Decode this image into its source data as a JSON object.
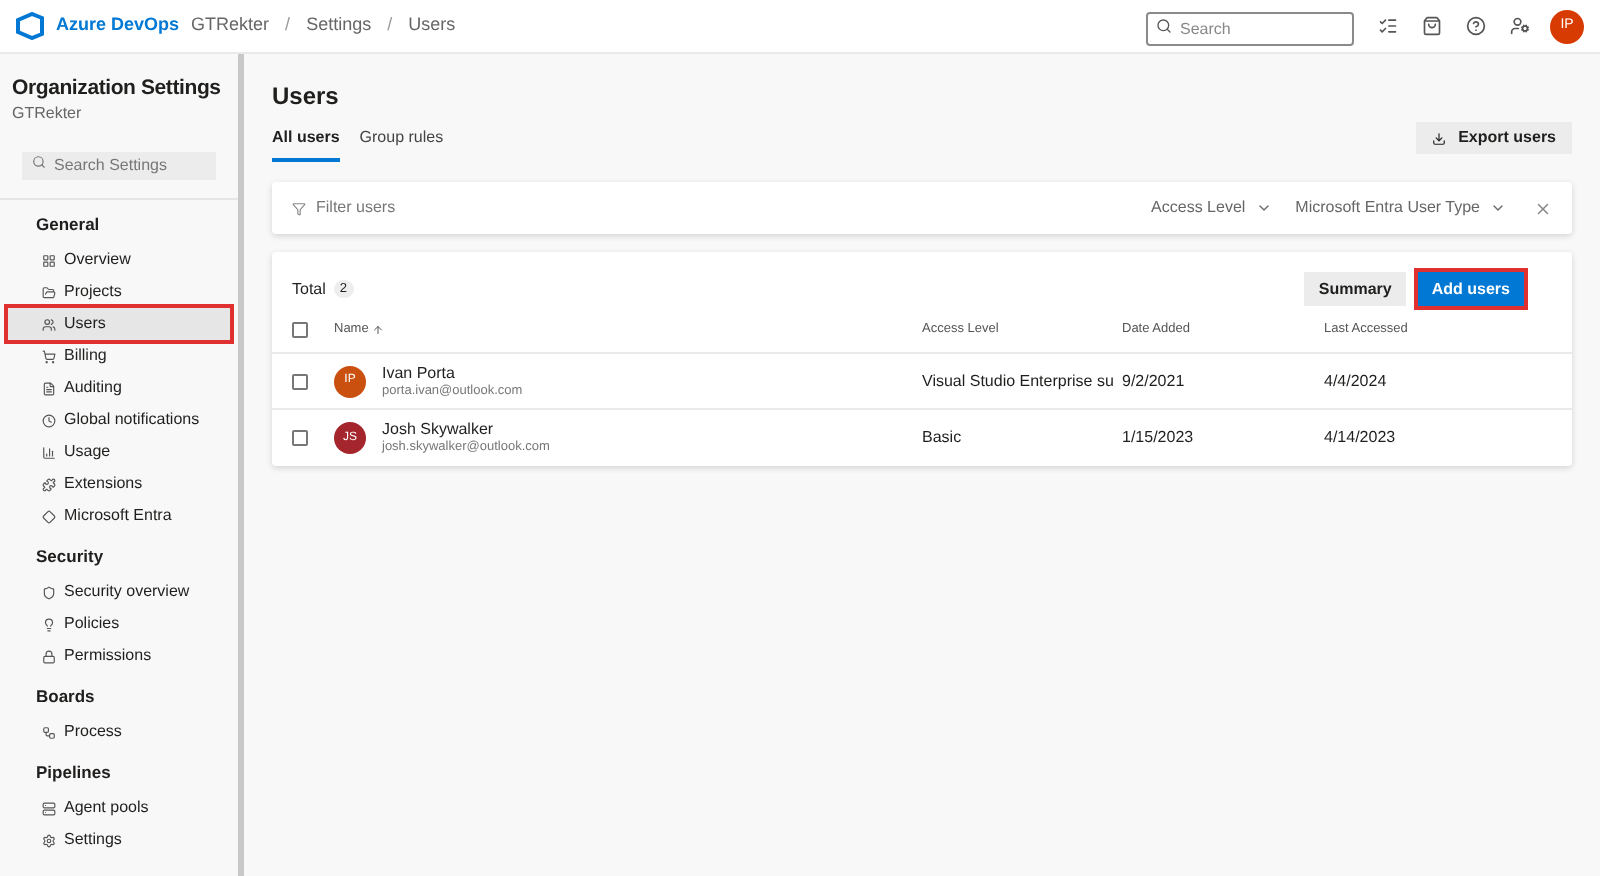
{
  "header": {
    "product": "Azure DevOps",
    "breadcrumbs": [
      "GTRekter",
      "Settings",
      "Users"
    ],
    "separator": "/",
    "search_placeholder": "Search",
    "avatar": "IP"
  },
  "sidebar": {
    "title": "Organization Settings",
    "subtitle": "GTRekter",
    "search_placeholder": "Search Settings",
    "sections": [
      {
        "title": "General",
        "items": [
          {
            "label": "Overview",
            "selected": false,
            "highlighted": false
          },
          {
            "label": "Projects",
            "selected": false,
            "highlighted": false
          },
          {
            "label": "Users",
            "selected": true,
            "highlighted": true
          },
          {
            "label": "Billing",
            "selected": false,
            "highlighted": false
          },
          {
            "label": "Auditing",
            "selected": false,
            "highlighted": false
          },
          {
            "label": "Global notifications",
            "selected": false,
            "highlighted": false
          },
          {
            "label": "Usage",
            "selected": false,
            "highlighted": false
          },
          {
            "label": "Extensions",
            "selected": false,
            "highlighted": false
          },
          {
            "label": "Microsoft Entra",
            "selected": false,
            "highlighted": false
          }
        ]
      },
      {
        "title": "Security",
        "items": [
          {
            "label": "Security overview",
            "selected": false,
            "highlighted": false
          },
          {
            "label": "Policies",
            "selected": false,
            "highlighted": false
          },
          {
            "label": "Permissions",
            "selected": false,
            "highlighted": false
          }
        ]
      },
      {
        "title": "Boards",
        "items": [
          {
            "label": "Process",
            "selected": false,
            "highlighted": false
          }
        ]
      },
      {
        "title": "Pipelines",
        "items": [
          {
            "label": "Agent pools",
            "selected": false,
            "highlighted": false
          },
          {
            "label": "Settings",
            "selected": false,
            "highlighted": false
          }
        ]
      }
    ]
  },
  "page": {
    "title": "Users",
    "tabs": [
      {
        "label": "All users",
        "selected": true
      },
      {
        "label": "Group rules",
        "selected": false
      }
    ],
    "export_button": "Export users"
  },
  "filter": {
    "placeholder": "Filter users",
    "dropdowns": [
      "Access Level",
      "Microsoft Entra User Type"
    ]
  },
  "table": {
    "total_label": "Total",
    "total_count": "2",
    "summary_button": "Summary",
    "add_button": {
      "label": "Add users",
      "highlighted": true
    },
    "select_all_checked": false,
    "columns": [
      "Name",
      "Access Level",
      "Date Added",
      "Last Accessed"
    ],
    "rows": [
      {
        "initials": "IP",
        "color": "#ca5010",
        "name": "Ivan Porta",
        "email": "porta.ivan@outlook.com",
        "access_level": "Visual Studio Enterprise su",
        "date_added": "9/2/2021",
        "last_accessed": "4/4/2024",
        "checked": false
      },
      {
        "initials": "JS",
        "color": "#a4262c",
        "name": "Josh Skywalker",
        "email": "josh.skywalker@outlook.com",
        "access_level": "Basic",
        "date_added": "1/15/2023",
        "last_accessed": "4/14/2023",
        "checked": false
      }
    ]
  }
}
